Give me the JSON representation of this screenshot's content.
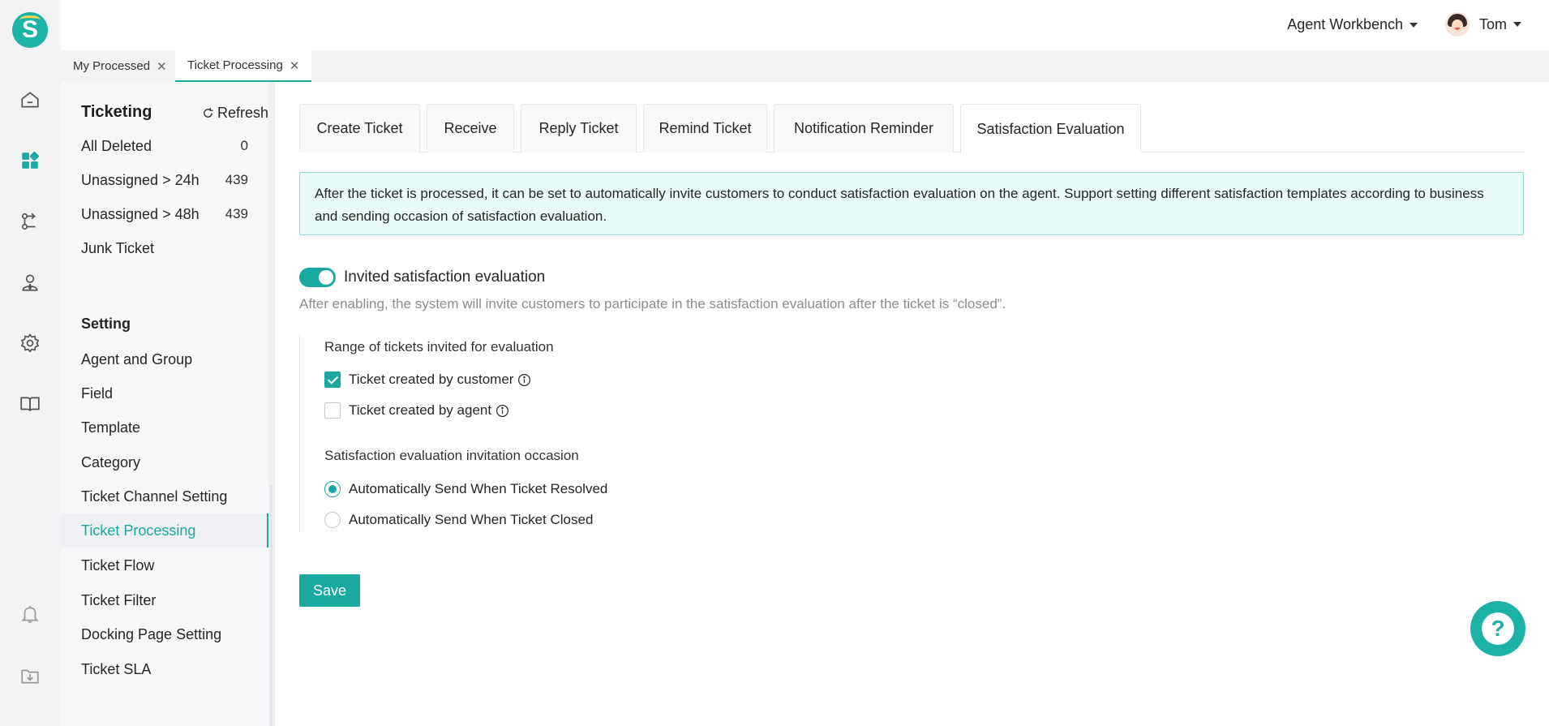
{
  "header": {
    "workbench_label": "Agent Workbench",
    "user_name": "Tom",
    "logo_letter": "S"
  },
  "rail": {
    "icons": [
      "home-icon",
      "dashboard-icon",
      "routing-icon",
      "agent-icon",
      "settings-icon",
      "book-icon",
      "bell-icon",
      "download-icon"
    ]
  },
  "page_tabs": [
    {
      "label": "My Processed",
      "close": "✕"
    },
    {
      "label": "Ticket Processing",
      "close": "✕"
    }
  ],
  "sidebar": {
    "title": "Ticketing",
    "refresh_label": "Refresh",
    "items": [
      {
        "label": "All Deleted",
        "count": "0"
      },
      {
        "label": "Unassigned > 24h",
        "count": "439"
      },
      {
        "label": "Unassigned > 48h",
        "count": "439"
      },
      {
        "label": "Junk Ticket",
        "count": ""
      }
    ],
    "setting_title": "Setting",
    "setting_items": [
      "Agent and Group",
      "Field",
      "Template",
      "Category",
      "Ticket Channel Setting",
      "Ticket Processing",
      "Ticket Flow",
      "Ticket Filter",
      "Docking Page Setting",
      "Ticket SLA"
    ],
    "active_item": "Ticket Processing"
  },
  "subtabs": [
    "Create Ticket",
    "Receive",
    "Reply Ticket",
    "Remind Ticket",
    "Notification Reminder",
    "Satisfaction Evaluation"
  ],
  "active_subtab": "Satisfaction Evaluation",
  "info_text": "After the ticket is processed, it can be set to automatically invite customers to conduct satisfaction evaluation on the agent. Support setting different satisfaction templates according to business and sending occasion of satisfaction evaluation.",
  "toggle": {
    "label": "Invited satisfaction evaluation",
    "enabled": true,
    "description": "After enabling, the system will invite customers to participate in the satisfaction evaluation after the ticket is “closed”."
  },
  "range": {
    "label": "Range of tickets invited for evaluation",
    "options": [
      {
        "label": "Ticket created by customer",
        "checked": true
      },
      {
        "label": "Ticket created by agent",
        "checked": false
      }
    ]
  },
  "occasion": {
    "label": "Satisfaction evaluation invitation occasion",
    "options": [
      {
        "label": "Automatically Send When Ticket Resolved",
        "selected": true
      },
      {
        "label": "Automatically Send When Ticket Closed",
        "selected": false
      }
    ]
  },
  "save_label": "Save",
  "help_label": "?",
  "colors": {
    "accent": "#1aa9a0",
    "info_bg": "#e9fbf9",
    "rail_bg": "#f2f3f5"
  }
}
